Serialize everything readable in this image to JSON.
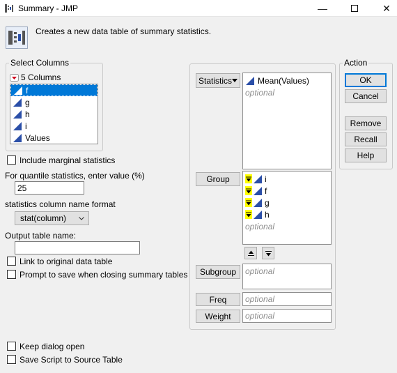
{
  "window": {
    "title": "Summary - JMP",
    "controls": [
      "minimize",
      "maximize",
      "close"
    ]
  },
  "description": "Creates a new data table of summary statistics.",
  "select_columns": {
    "legend": "Select Columns",
    "count_label": "5 Columns",
    "columns": [
      "f",
      "g",
      "h",
      "i",
      "Values"
    ],
    "selected_index": 0
  },
  "options": {
    "include_marginal": "Include marginal statistics",
    "quantile_label": "For quantile statistics, enter value (%)",
    "quantile_value": "25",
    "name_format_label": "statistics column name format",
    "name_format_value": "stat(column)",
    "output_name_label": "Output table name:",
    "output_name_value": "",
    "link_label": "Link to original data table",
    "prompt_label": "Prompt to save when closing summary tables",
    "keep_open": "Keep dialog open",
    "save_script": "Save Script to Source Table"
  },
  "roles": {
    "statistics_button": "Statistics",
    "statistics_items": [
      "Mean(Values)"
    ],
    "statistics_placeholder": "optional",
    "group_button": "Group",
    "group_items": [
      "i",
      "f",
      "g",
      "h"
    ],
    "group_placeholder": "optional",
    "subgroup_button": "Subgroup",
    "subgroup_placeholder": "optional",
    "freq_button": "Freq",
    "freq_placeholder": "optional",
    "weight_button": "Weight",
    "weight_placeholder": "optional"
  },
  "action": {
    "legend": "Action",
    "ok": "OK",
    "cancel": "Cancel",
    "remove": "Remove",
    "recall": "Recall",
    "help": "Help"
  },
  "colors": {
    "accent": "#0078d7",
    "highlight": "#ffff00",
    "triangle_red": "#d0021b",
    "icon_blue": "#2b4fa8"
  }
}
